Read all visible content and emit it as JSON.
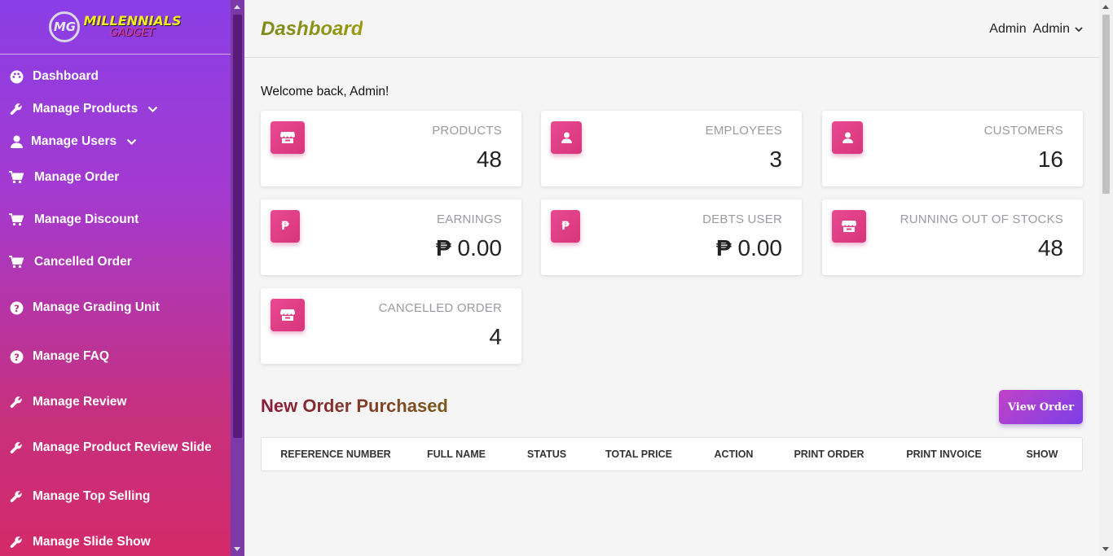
{
  "brand": {
    "line1": "MILLENNIALS",
    "line2": "GADGET",
    "mark": "MG"
  },
  "sidebar": {
    "items": [
      {
        "label": "Dashboard",
        "icon": "palette-icon"
      },
      {
        "label": "Manage Products",
        "icon": "wrench-icon",
        "dropdown": true
      },
      {
        "label": "Manage Users",
        "icon": "user-icon",
        "dropdown": true
      },
      {
        "label": "Manage Order",
        "icon": "cart-icon"
      },
      {
        "label": "Manage Discount",
        "icon": "cart-icon"
      },
      {
        "label": "Cancelled Order",
        "icon": "cart-icon"
      },
      {
        "label": "Manage Grading Unit",
        "icon": "question-circle-icon"
      },
      {
        "label": "Manage FAQ",
        "icon": "question-circle-icon"
      },
      {
        "label": "Manage Review",
        "icon": "wrench-icon"
      },
      {
        "label": "Manage Product Review Slide",
        "icon": "wrench-icon"
      },
      {
        "label": "Manage Top Selling",
        "icon": "wrench-icon"
      },
      {
        "label": "Manage Slide Show",
        "icon": "wrench-icon"
      }
    ]
  },
  "header": {
    "title": "Dashboard",
    "user": "Admin  Admin"
  },
  "welcome": "Welcome back, Admin!",
  "cards": [
    {
      "label": "PRODUCTS",
      "value": "48",
      "icon": "store-icon"
    },
    {
      "label": "EMPLOYEES",
      "value": "3",
      "icon": "user-icon"
    },
    {
      "label": "CUSTOMERS",
      "value": "16",
      "icon": "user-icon"
    },
    {
      "label": "EARNINGS",
      "currency": "₱",
      "value": "0.00",
      "icon": "peso-icon"
    },
    {
      "label": "DEBTS USER",
      "currency": "₱",
      "value": "0.00",
      "icon": "peso-icon"
    },
    {
      "label": "RUNNING OUT OF STOCKS",
      "value": "48",
      "icon": "store-icon"
    },
    {
      "label": "CANCELLED ORDER",
      "value": "4",
      "icon": "store-icon"
    }
  ],
  "orders": {
    "title": "New Order Purchased",
    "view_button": "View Order",
    "columns": [
      "REFERENCE NUMBER",
      "FULL NAME",
      "STATUS",
      "TOTAL PRICE",
      "ACTION",
      "PRINT ORDER",
      "PRINT INVOICE",
      "SHOW"
    ]
  },
  "colors": {
    "accent_pink": "#e84a90",
    "sidebar_top": "#8a3ee6",
    "sidebar_bottom": "#d42a6a",
    "button_purple": "#7c3ee8"
  }
}
